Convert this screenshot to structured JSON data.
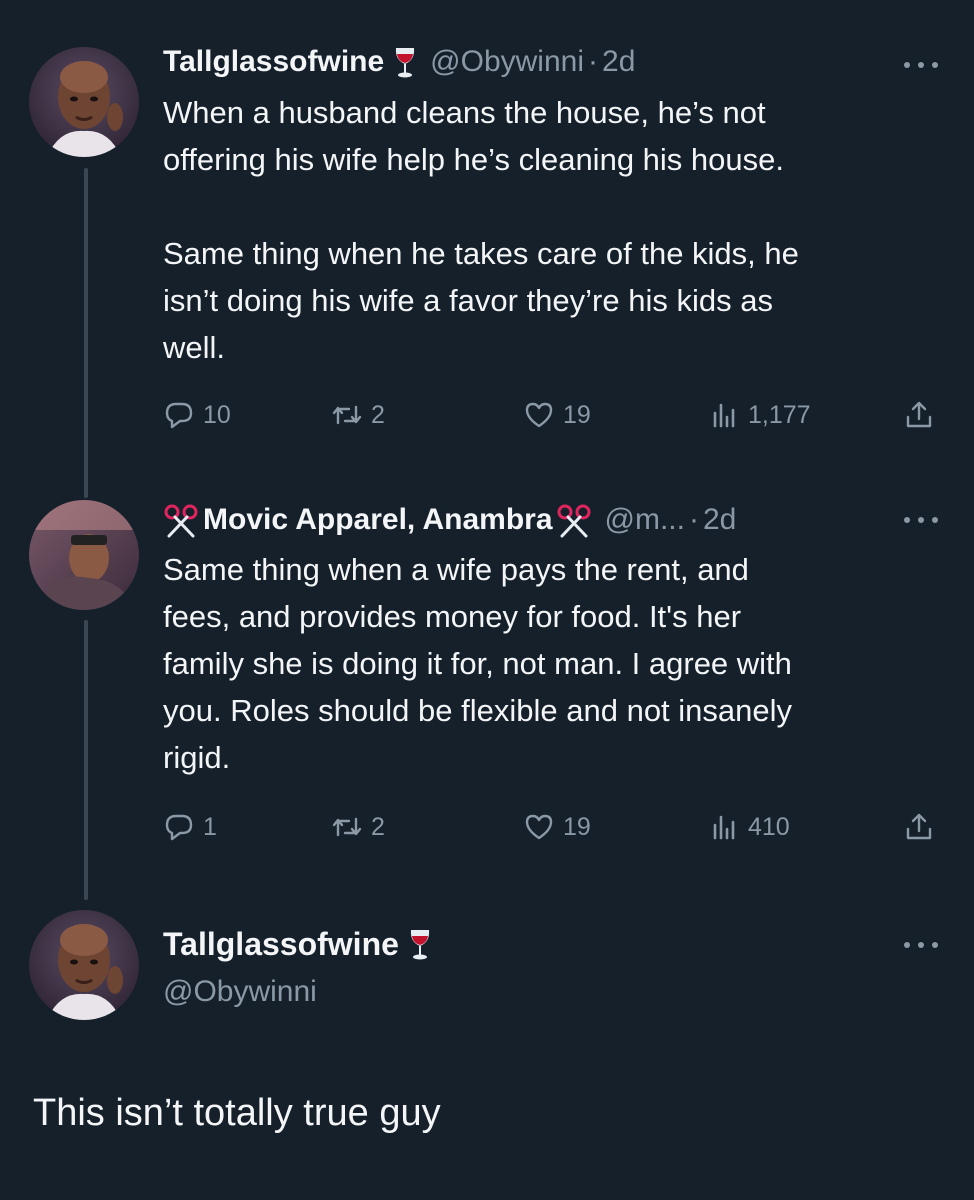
{
  "tweet1": {
    "name": "Tallglassofwine",
    "handle": "@Obywinni",
    "sep": "·",
    "time": "2d",
    "text": "When a husband cleans the house, he’s not\noffering his wife help he’s cleaning his house.\n\nSame thing when he takes care of the kids, he\nisn’t doing his wife a favor they’re his kids as\nwell.",
    "replies": "10",
    "retweets": "2",
    "likes": "19",
    "views": "1,177",
    "icons": [
      "wine-glass-icon",
      "more-icon",
      "reply-icon",
      "retweet-icon",
      "heart-icon",
      "views-icon",
      "share-icon"
    ]
  },
  "tweet2": {
    "name": "Movic Apparel, Anambra",
    "handle": "@m...",
    "sep": "·",
    "time": "2d",
    "text": "Same thing when a wife pays the rent, and\nfees, and provides money for food. It's her\nfamily she is doing it for, not man. I agree with\nyou. Roles should be flexible and not insanely\nrigid.",
    "replies": "1",
    "retweets": "2",
    "likes": "19",
    "views": "410",
    "icons": [
      "scissors-icon",
      "more-icon",
      "reply-icon",
      "retweet-icon",
      "heart-icon",
      "views-icon",
      "share-icon"
    ]
  },
  "tweet3": {
    "name": "Tallglassofwine",
    "handle": "@Obywinni",
    "text": "This isn’t totally true guy",
    "icons": [
      "wine-glass-icon",
      "more-icon"
    ]
  },
  "colors": {
    "background": "#15202b",
    "text": "#f3f5f7",
    "muted": "#8b98a5",
    "thread_line": "#3b4753",
    "scissors": "#e0245e"
  }
}
